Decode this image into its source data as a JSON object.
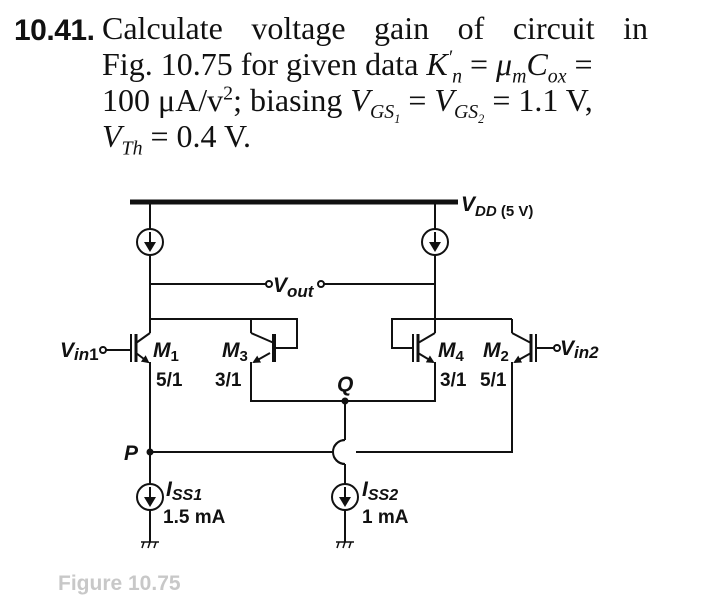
{
  "problem": {
    "number": "10.41.",
    "line1": "Calculate voltage gain of circuit in",
    "line2_prefix": "Fig. 10.75 for given data ",
    "k_symbol": "K",
    "k_sub": "n",
    "k_prime": "′",
    "eq1": " = ",
    "mu": "μ",
    "mu_sub": "m",
    "c": "C",
    "c_sub": "ox",
    "eq2": " =",
    "line3_value": "100 ",
    "line3_unit": "μA/v",
    "line3_sup": "2",
    "line3_mid": "; biasing ",
    "vgs": "V",
    "vgs1_sub": "GS",
    "vgs1_subsub": "1",
    "vgs2_subsub": "2",
    "eq3": " = ",
    "line3_end": " = 1.1 V,",
    "vth": "V",
    "vth_sub": "Th",
    "line4_end": " = 0.4 V."
  },
  "circuit": {
    "vdd_label": "V",
    "vdd_sub": "DD",
    "vdd_value": " (5 V)",
    "vout_label": "V",
    "vout_sub": "out",
    "vin1_label": "V",
    "vin1_sub": "in",
    "vin1_idx": "1",
    "vin2_label": "V",
    "vin2_sub": "in2",
    "m1": "M",
    "m1_sub": "1",
    "m1_ratio": "5/1",
    "m3": "M",
    "m3_sub": "3",
    "m3_ratio": "3/1",
    "m4": "M",
    "m4_sub": "4",
    "m4_ratio": "3/1",
    "m2": "M",
    "m2_sub": "2",
    "m2_ratio": "5/1",
    "node_q": "Q",
    "node_p": "P",
    "iss1": "I",
    "iss1_sub": "SS1",
    "iss1_value": "1.5 mA",
    "iss2": "I",
    "iss2_sub": "SS2",
    "iss2_value": "1 mA"
  },
  "caption": "Figure 10.75"
}
